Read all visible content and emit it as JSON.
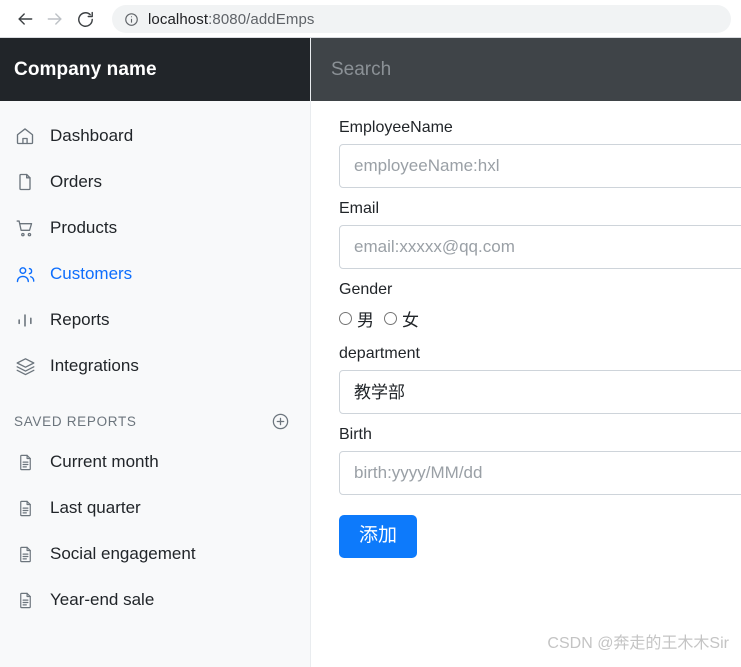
{
  "browser": {
    "back_icon": "arrow-left-icon",
    "forward_icon": "arrow-right-icon",
    "reload_icon": "reload-icon",
    "site_info_icon": "info-circle-icon",
    "url_host": "localhost",
    "url_path": ":8080/addEmps",
    "url_full": "localhost:8080/addEmps"
  },
  "sidebar": {
    "brand": "Company name",
    "nav_items": [
      {
        "label": "Dashboard",
        "icon": "home-icon",
        "active": false
      },
      {
        "label": "Orders",
        "icon": "file-icon",
        "active": false
      },
      {
        "label": "Products",
        "icon": "cart-icon",
        "active": false
      },
      {
        "label": "Customers",
        "icon": "people-icon",
        "active": true
      },
      {
        "label": "Reports",
        "icon": "bar-chart-icon",
        "active": false
      },
      {
        "label": "Integrations",
        "icon": "layers-icon",
        "active": false
      }
    ],
    "saved_reports_label": "SAVED REPORTS",
    "add_report_icon": "plus-circle-icon",
    "saved_reports": [
      {
        "label": "Current month",
        "icon": "document-icon"
      },
      {
        "label": "Last quarter",
        "icon": "document-icon"
      },
      {
        "label": "Social engagement",
        "icon": "document-icon"
      },
      {
        "label": "Year-end sale",
        "icon": "document-icon"
      }
    ]
  },
  "search": {
    "placeholder": "Search",
    "value": ""
  },
  "form": {
    "employee_name": {
      "label": "EmployeeName",
      "placeholder": "employeeName:hxl",
      "value": ""
    },
    "email": {
      "label": "Email",
      "placeholder": "email:xxxxx@qq.com",
      "value": ""
    },
    "gender": {
      "label": "Gender",
      "options": [
        {
          "label": "男",
          "checked": false
        },
        {
          "label": "女",
          "checked": false
        }
      ]
    },
    "department": {
      "label": "department",
      "selected": "教学部",
      "options": [
        "教学部"
      ]
    },
    "birth": {
      "label": "Birth",
      "placeholder": "birth:yyyy/MM/dd",
      "value": ""
    },
    "submit_label": "添加"
  },
  "watermark": "CSDN @奔走的王木木Sir",
  "colors": {
    "brand_bg": "#212529",
    "searchbar_bg": "#3f4448",
    "sidebar_bg": "#f8f9fa",
    "accent": "#0d6efd",
    "button_blue": "#0d7afb"
  }
}
